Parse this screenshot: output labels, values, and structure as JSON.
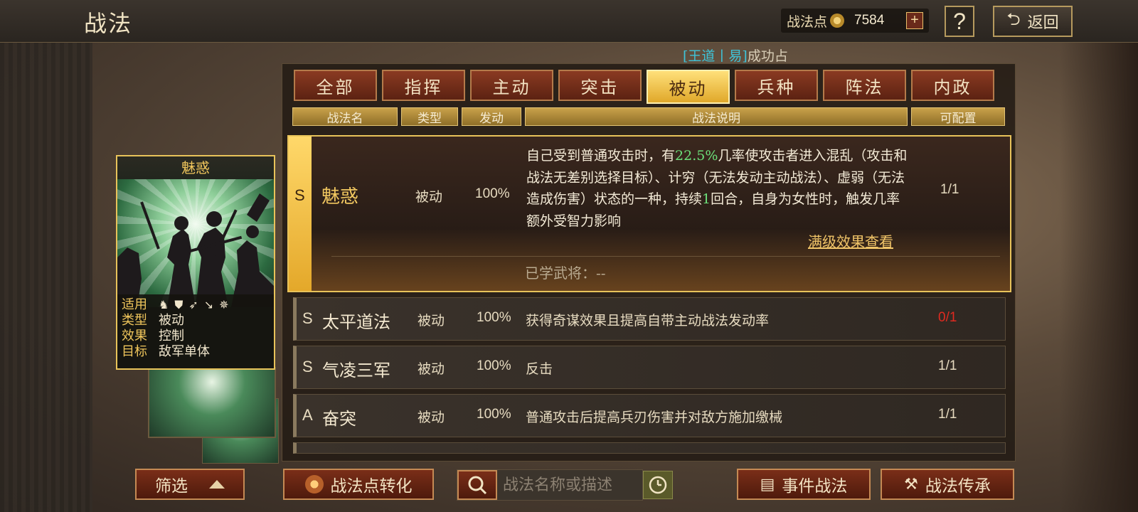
{
  "header": {
    "title": "战法",
    "points_label": "战法点",
    "points_value": "7584",
    "plus": "+",
    "help": "?",
    "back_label": "返回"
  },
  "ticker": {
    "highlight": "[王道丨易]",
    "text": "成功占"
  },
  "tabs": [
    {
      "label": "全部"
    },
    {
      "label": "指挥"
    },
    {
      "label": "主动"
    },
    {
      "label": "突击"
    },
    {
      "label": "被动",
      "active": true
    },
    {
      "label": "兵种"
    },
    {
      "label": "阵法"
    },
    {
      "label": "内政"
    }
  ],
  "columns": [
    "战法名",
    "类型",
    "发动",
    "战法说明",
    "可配置"
  ],
  "expanded": {
    "grade": "S",
    "name": "魅惑",
    "type": "被动",
    "rate": "100%",
    "desc_parts": [
      "自己受到普通攻击时，有",
      "22.5%",
      "几率使攻击者进入混乱（攻击和战法无差别选择目标）、计穷（无法发动主动战法）、虚弱（无法造成伤害）状态的一种，持续",
      "1",
      "回合，自身为女性时，触发几率额外受智力影响"
    ],
    "config": "1/1",
    "link": "满级效果查看",
    "learned": "已学武将：--"
  },
  "rows": [
    {
      "grade": "S",
      "name": "太平道法",
      "type": "被动",
      "rate": "100%",
      "desc": "获得奇谋效果且提高自带主动战法发动率",
      "config": "0/1",
      "config_red": true
    },
    {
      "grade": "S",
      "name": "气凌三军",
      "type": "被动",
      "rate": "100%",
      "desc": "反击",
      "config": "1/1"
    },
    {
      "grade": "A",
      "name": "奋突",
      "type": "被动",
      "rate": "100%",
      "desc": "普通攻击后提高兵刃伤害并对敌方施加缴械",
      "config": "1/1"
    }
  ],
  "card": {
    "title": "魅惑",
    "labels": {
      "apply": "适用",
      "type": "类型",
      "effect": "效果",
      "target": "目标"
    },
    "type": "被动",
    "effect": "控制",
    "target": "敌军单体",
    "troop_icons": [
      "cavalry-icon",
      "shield-icon",
      "bow-icon",
      "spear-icon",
      "wheel-icon"
    ]
  },
  "bottom": {
    "filter": "筛选",
    "convert": "战法点转化",
    "search_placeholder": "战法名称或描述",
    "event": "事件战法",
    "inherit": "战法传承"
  },
  "colors": {
    "gold": "#e8c35a",
    "highlight_green": "#6ce07a",
    "red": "#e02a20",
    "ticker_cyan": "#3fc3d8"
  }
}
